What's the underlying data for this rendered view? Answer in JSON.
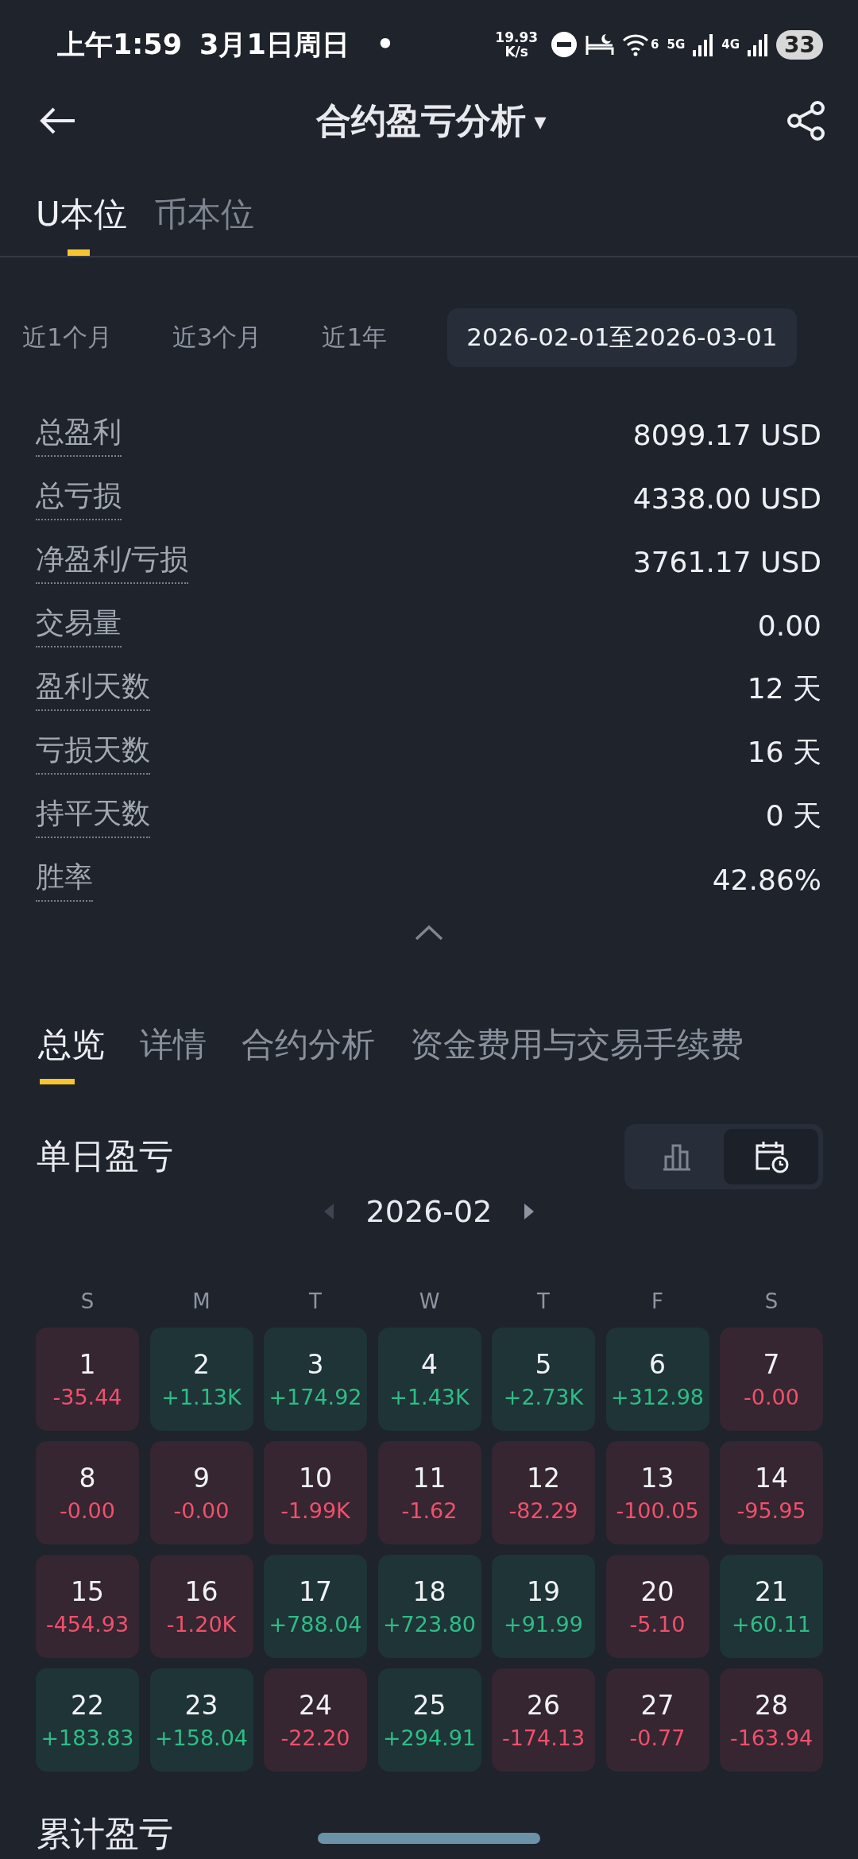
{
  "status_bar": {
    "time": "上午1:59",
    "date": "3月1日周日",
    "dot": "•",
    "speed_value": "19.93",
    "speed_unit": "K/s",
    "wifi_badge": "6",
    "net_5g": "5G",
    "net_4g": "4G",
    "battery": "33"
  },
  "header": {
    "title": "合约盈亏分析",
    "dropdown": "▾"
  },
  "tabs": [
    {
      "label": "U本位",
      "selected": true
    },
    {
      "label": "币本位",
      "selected": false
    }
  ],
  "periods": [
    {
      "label": "近1个月",
      "selected": false
    },
    {
      "label": "近3个月",
      "selected": false
    },
    {
      "label": "近1年",
      "selected": false
    },
    {
      "label": "2026-02-01至2026-03-01",
      "selected": true
    }
  ],
  "stats": [
    {
      "label": "总盈利",
      "value": "8099.17 USD"
    },
    {
      "label": "总亏损",
      "value": "4338.00 USD"
    },
    {
      "label": "净盈利/亏损",
      "value": "3761.17 USD"
    },
    {
      "label": "交易量",
      "value": "0.00"
    },
    {
      "label": "盈利天数",
      "value": "12 天"
    },
    {
      "label": "亏损天数",
      "value": "16 天"
    },
    {
      "label": "持平天数",
      "value": "0 天"
    },
    {
      "label": "胜率",
      "value": "42.86%"
    }
  ],
  "section_tabs": [
    {
      "label": "总览",
      "selected": true
    },
    {
      "label": "详情",
      "selected": false
    },
    {
      "label": "合约分析",
      "selected": false
    },
    {
      "label": "资金费用与交易手续费",
      "selected": false
    }
  ],
  "daily": {
    "title": "单日盈亏",
    "views": [
      {
        "kind": "bar",
        "selected": false
      },
      {
        "kind": "calendar",
        "selected": true
      }
    ],
    "month": "2026-02",
    "weekdays": [
      "S",
      "M",
      "T",
      "W",
      "T",
      "F",
      "S"
    ],
    "days": [
      {
        "day": "1",
        "value": "-35.44",
        "kind": "loss"
      },
      {
        "day": "2",
        "value": "+1.13K",
        "kind": "profit"
      },
      {
        "day": "3",
        "value": "+174.92",
        "kind": "profit"
      },
      {
        "day": "4",
        "value": "+1.43K",
        "kind": "profit"
      },
      {
        "day": "5",
        "value": "+2.73K",
        "kind": "profit"
      },
      {
        "day": "6",
        "value": "+312.98",
        "kind": "profit"
      },
      {
        "day": "7",
        "value": "-0.00",
        "kind": "loss"
      },
      {
        "day": "8",
        "value": "-0.00",
        "kind": "loss"
      },
      {
        "day": "9",
        "value": "-0.00",
        "kind": "loss"
      },
      {
        "day": "10",
        "value": "-1.99K",
        "kind": "loss"
      },
      {
        "day": "11",
        "value": "-1.62",
        "kind": "loss"
      },
      {
        "day": "12",
        "value": "-82.29",
        "kind": "loss"
      },
      {
        "day": "13",
        "value": "-100.05",
        "kind": "loss"
      },
      {
        "day": "14",
        "value": "-95.95",
        "kind": "loss"
      },
      {
        "day": "15",
        "value": "-454.93",
        "kind": "loss"
      },
      {
        "day": "16",
        "value": "-1.20K",
        "kind": "loss"
      },
      {
        "day": "17",
        "value": "+788.04",
        "kind": "profit"
      },
      {
        "day": "18",
        "value": "+723.80",
        "kind": "profit"
      },
      {
        "day": "19",
        "value": "+91.99",
        "kind": "profit"
      },
      {
        "day": "20",
        "value": "-5.10",
        "kind": "loss"
      },
      {
        "day": "21",
        "value": "+60.11",
        "kind": "profit"
      },
      {
        "day": "22",
        "value": "+183.83",
        "kind": "profit"
      },
      {
        "day": "23",
        "value": "+158.04",
        "kind": "profit"
      },
      {
        "day": "24",
        "value": "-22.20",
        "kind": "loss"
      },
      {
        "day": "25",
        "value": "+294.91",
        "kind": "profit"
      },
      {
        "day": "26",
        "value": "-174.13",
        "kind": "loss"
      },
      {
        "day": "27",
        "value": "-0.77",
        "kind": "loss"
      },
      {
        "day": "28",
        "value": "-163.94",
        "kind": "loss"
      }
    ]
  },
  "cumulative": {
    "title": "累计盈亏"
  }
}
